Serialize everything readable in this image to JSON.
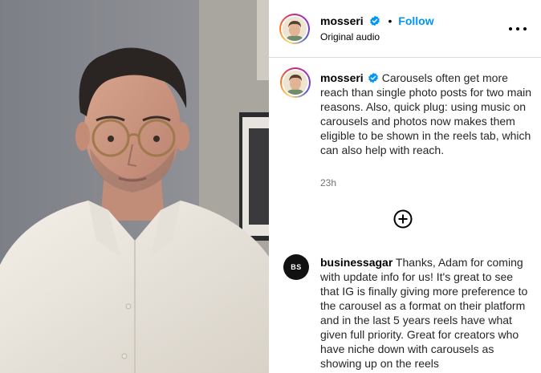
{
  "post": {
    "author": "mosseri",
    "follow_label": "Follow",
    "separator": "•",
    "audio_label": "Original audio",
    "more_icon": "more-horizontal-icon"
  },
  "caption": {
    "author": "mosseri",
    "text": "Carousels often get more reach than single photo posts for two main reasons. Also, quick plug: using music on carousels and photos now makes them eligible to be shown in the reels tab, which can also help with reach.",
    "time": "23h"
  },
  "comment": {
    "author": "businessagar",
    "avatar_initials": "BS",
    "text": "Thanks, Adam for coming with update info for us! It's great to see that IG is finally giving more preference to the carousel as a format on their platform and in the last 5 years reels have what given full priority. Great for creators who have niche down with carousels as showing up on the reels"
  },
  "colors": {
    "accent": "#0095f6",
    "verified": "#0095f6",
    "meta_text": "#737373"
  }
}
